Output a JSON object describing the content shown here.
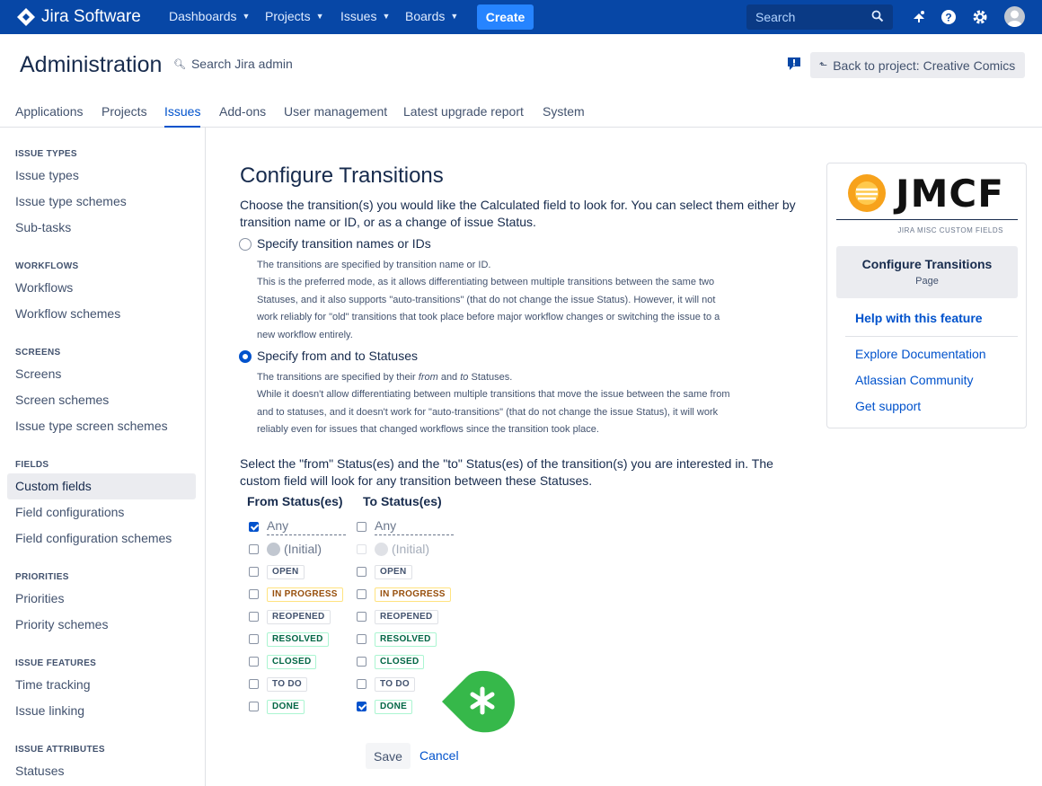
{
  "topnav": {
    "logo_text": "Jira Software",
    "items": [
      {
        "label": "Dashboards"
      },
      {
        "label": "Projects"
      },
      {
        "label": "Issues"
      },
      {
        "label": "Boards"
      }
    ],
    "create_label": "Create",
    "search_placeholder": "Search"
  },
  "admin": {
    "title": "Administration",
    "search_label": "Search Jira admin",
    "back_label": "Back to project: Creative Comics"
  },
  "tabs": [
    {
      "label": "Applications"
    },
    {
      "label": "Projects"
    },
    {
      "label": "Issues",
      "active": true
    },
    {
      "label": "Add-ons"
    },
    {
      "label": "User management"
    },
    {
      "label": "Latest upgrade report"
    },
    {
      "label": "System"
    }
  ],
  "sidebar": {
    "sections": [
      {
        "heading": "ISSUE TYPES",
        "items": [
          "Issue types",
          "Issue type schemes",
          "Sub-tasks"
        ]
      },
      {
        "heading": "WORKFLOWS",
        "items": [
          "Workflows",
          "Workflow schemes"
        ]
      },
      {
        "heading": "SCREENS",
        "items": [
          "Screens",
          "Screen schemes",
          "Issue type screen schemes"
        ]
      },
      {
        "heading": "FIELDS",
        "items": [
          "Custom fields",
          "Field configurations",
          "Field configuration schemes"
        ]
      },
      {
        "heading": "PRIORITIES",
        "items": [
          "Priorities",
          "Priority schemes"
        ]
      },
      {
        "heading": "ISSUE FEATURES",
        "items": [
          "Time tracking",
          "Issue linking"
        ]
      },
      {
        "heading": "ISSUE ATTRIBUTES",
        "items": [
          "Statuses"
        ]
      }
    ],
    "active_item": "Custom fields"
  },
  "main": {
    "title": "Configure Transitions",
    "intro": "Choose the transition(s) you would like the Calculated field to look for. You can select them either by transition name or ID, or as a change of issue Status.",
    "option1": {
      "label": "Specify transition names or IDs",
      "selected": false,
      "desc_lines": [
        "The transitions are specified by transition name or ID.",
        "This is the preferred mode, as it allows differentiating between multiple transitions between the same two",
        "Statuses, and it also supports \"auto-transitions\" (that do not change the issue Status). However, it will not",
        "work reliably for \"old\" transitions that took place before major workflow changes or switching the issue to a",
        "new workflow entirely."
      ]
    },
    "option2": {
      "label": "Specify from and to Statuses",
      "selected": true,
      "desc_line1_a": "The transitions are specified by their ",
      "desc_line1_from": "from",
      "desc_line1_b": " and ",
      "desc_line1_to": "to",
      "desc_line1_c": " Statuses.",
      "desc_lines": [
        "While it doesn't allow differentiating between multiple transitions that move the issue between the same from",
        "and to statuses, and it doesn't work for \"auto-transitions\" (that do not change the issue Status), it will work",
        "reliably even for issues that changed workflows since the transition took place."
      ]
    },
    "select_text": "Select the \"from\" Status(es) and the \"to\" Status(es) of the transition(s) you are interested in. The custom field will look for any transition between these Statuses.",
    "from_heading": "From Status(es)",
    "to_heading": "To Status(es)",
    "any_label": "Any",
    "initial_label": "(Initial)",
    "statuses": [
      {
        "label": "OPEN",
        "color": "grey",
        "from": false,
        "to": false
      },
      {
        "label": "IN PROGRESS",
        "color": "yellow",
        "from": false,
        "to": false
      },
      {
        "label": "REOPENED",
        "color": "grey",
        "from": false,
        "to": false
      },
      {
        "label": "RESOLVED",
        "color": "green",
        "from": false,
        "to": false
      },
      {
        "label": "CLOSED",
        "color": "green",
        "from": false,
        "to": false
      },
      {
        "label": "TO DO",
        "color": "grey",
        "from": false,
        "to": false
      },
      {
        "label": "DONE",
        "color": "green",
        "from": false,
        "to": true
      }
    ],
    "from_any_checked": true,
    "to_any_checked": false,
    "save_label": "Save",
    "cancel_label": "Cancel"
  },
  "panel": {
    "logo_text": "JMCF",
    "logo_sub": "JIRA MISC CUSTOM FIELDS",
    "box_title": "Configure Transitions",
    "box_sub": "Page",
    "help_label": "Help with this feature",
    "links": [
      "Explore Documentation",
      "Atlassian Community",
      "Get support"
    ]
  },
  "colors": {
    "topbar": "#0747a6",
    "accent": "#0052cc",
    "badge_green": "#36b84a"
  }
}
